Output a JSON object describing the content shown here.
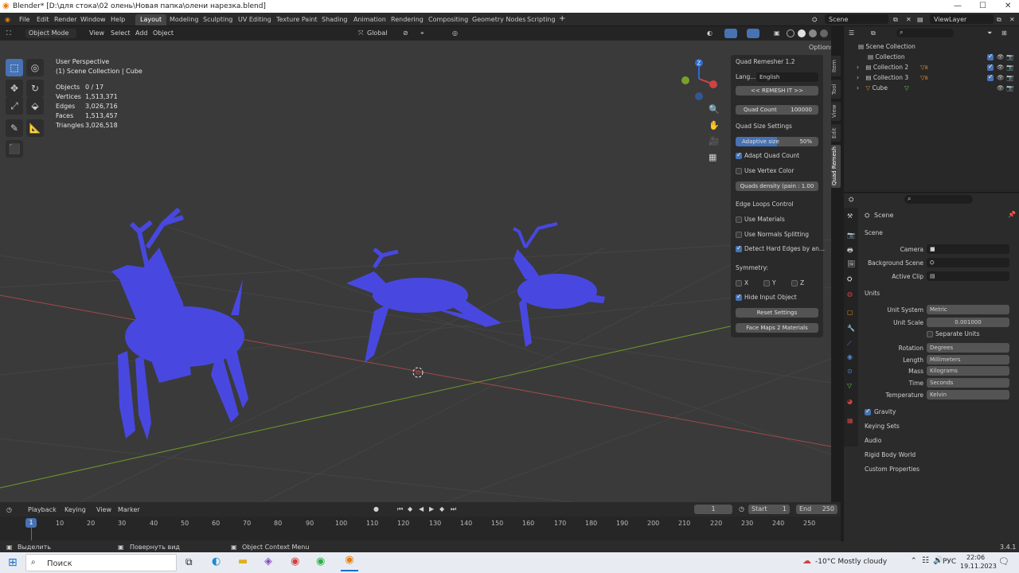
{
  "window": {
    "title": "Blender* [D:\\для стока\\02 олень\\Новая папка\\олени нарезка.blend]"
  },
  "menu": [
    "File",
    "Edit",
    "Render",
    "Window",
    "Help"
  ],
  "workspaces": [
    "Layout",
    "Modeling",
    "Sculpting",
    "UV Editing",
    "Texture Paint",
    "Shading",
    "Animation",
    "Rendering",
    "Compositing",
    "Geometry Nodes",
    "Scripting"
  ],
  "scene": {
    "name": "Scene",
    "view_layer": "ViewLayer"
  },
  "viewport_header": {
    "mode": "Object Mode",
    "view": "View",
    "select": "Select",
    "add": "Add",
    "object": "Object",
    "orientation": "Global",
    "options": "Options"
  },
  "overlay": {
    "perspective": "User Perspective",
    "collection": "(1) Scene Collection | Cube"
  },
  "stats": [
    {
      "label": "Objects",
      "value": "0 / 17"
    },
    {
      "label": "Vertices",
      "value": "1,513,371"
    },
    {
      "label": "Edges",
      "value": "3,026,716"
    },
    {
      "label": "Faces",
      "value": "1,513,457"
    },
    {
      "label": "Triangles",
      "value": "3,026,518"
    }
  ],
  "gizmo": {
    "z": "Z",
    "y": "Y"
  },
  "quad_remesher": {
    "title": "Quad Remesher 1.2",
    "lang_label": "Lang...",
    "lang_value": "English",
    "remesh_btn": "<< REMESH IT >>",
    "quad_count_label": "Quad Count",
    "quad_count_value": "100000",
    "size_settings": "Quad Size Settings",
    "adaptive_label": "Adaptive size",
    "adaptive_value": "50%",
    "adaptive_fraction": 0.5,
    "adapt_quad_count": "Adapt Quad Count",
    "use_vertex_color": "Use Vertex Color",
    "density_label": "Quads density (pain : 1.00",
    "edge_loops": "Edge Loops Control",
    "use_materials": "Use Materials",
    "use_normals": "Use Normals Splitting",
    "detect_hard": "Detect Hard Edges by an...",
    "symmetry": "Symmetry:",
    "sym_x": "X",
    "sym_y": "Y",
    "sym_z": "Z",
    "hide_input": "Hide Input Object",
    "reset": "Reset Settings",
    "face_maps": "Face Maps 2 Materials"
  },
  "side_tabs": [
    "Item",
    "Tool",
    "View",
    "Edit",
    "Quad Remesh"
  ],
  "outliner": {
    "root": "Scene Collection",
    "rows": [
      {
        "name": "Collection",
        "badge": ""
      },
      {
        "name": "Collection 2",
        "badge": "8"
      },
      {
        "name": "Collection 3",
        "badge": "8"
      },
      {
        "name": "Cube",
        "badge": ""
      }
    ]
  },
  "properties": {
    "breadcrumb": "Scene",
    "scene_section": "Scene",
    "camera_label": "Camera",
    "bg_scene_label": "Background Scene",
    "active_clip_label": "Active Clip",
    "units_section": "Units",
    "unit_system_label": "Unit System",
    "unit_system": "Metric",
    "unit_scale_label": "Unit Scale",
    "unit_scale": "0.001000",
    "separate_units": "Separate Units",
    "rotation_label": "Rotation",
    "rotation": "Degrees",
    "length_label": "Length",
    "length": "Millimeters",
    "mass_label": "Mass",
    "mass": "Kilograms",
    "time_label": "Time",
    "time": "Seconds",
    "temperature_label": "Temperature",
    "temperature": "Kelvin",
    "collapsed": [
      "Gravity",
      "Keying Sets",
      "Audio",
      "Rigid Body World",
      "Custom Properties"
    ]
  },
  "timeline": {
    "playback": "Playback",
    "keying": "Keying",
    "view": "View",
    "marker": "Marker",
    "current": "1",
    "start_label": "Start",
    "start": "1",
    "end_label": "End",
    "end": "250",
    "frames": [
      "1",
      "10",
      "20",
      "30",
      "40",
      "50",
      "60",
      "70",
      "80",
      "90",
      "100",
      "110",
      "120",
      "130",
      "140",
      "150",
      "160",
      "170",
      "180",
      "190",
      "200",
      "210",
      "220",
      "230",
      "240",
      "250"
    ]
  },
  "statusbar": {
    "select": "Выделить",
    "rotate": "Повернуть вид",
    "context": "Object Context Menu",
    "version": "3.4.1"
  },
  "taskbar": {
    "search": "Поиск",
    "weather": "-10°C  Mostly cloudy",
    "lang": "РУС",
    "time": "22:06",
    "date": "19.11.2023"
  },
  "colors": {
    "accent": "#4772b3",
    "mesh": "#4848e0",
    "axis_x": "#c84848",
    "axis_y": "#7aa02c"
  }
}
